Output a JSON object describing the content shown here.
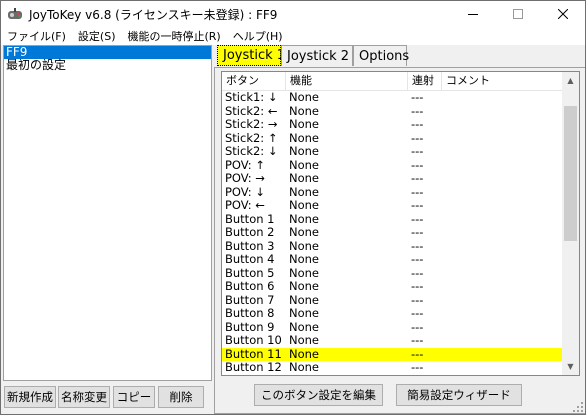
{
  "window": {
    "title": "JoyToKey v6.8 (ライセンスキー未登録) : FF9"
  },
  "menu": {
    "items": [
      {
        "label": "ファイル(F)"
      },
      {
        "label": "設定(S)"
      },
      {
        "label": "機能の一時停止(R)"
      },
      {
        "label": "ヘルプ(H)"
      }
    ]
  },
  "profiles": [
    "FF9",
    "最初の設定"
  ],
  "left_buttons": {
    "new": "新規作成",
    "rename": "名称変更",
    "copy": "コピー",
    "delete": "削除"
  },
  "tabs": [
    "Joystick 1",
    "Joystick 2",
    "Options"
  ],
  "list": {
    "columns": [
      "ボタン",
      "機能",
      "連射",
      "コメント"
    ],
    "rows": [
      {
        "button": "Stick1: ↓",
        "func": "None",
        "rapid": "---",
        "comment": ""
      },
      {
        "button": "Stick2: ←",
        "func": "None",
        "rapid": "---",
        "comment": ""
      },
      {
        "button": "Stick2: →",
        "func": "None",
        "rapid": "---",
        "comment": ""
      },
      {
        "button": "Stick2: ↑",
        "func": "None",
        "rapid": "---",
        "comment": ""
      },
      {
        "button": "Stick2: ↓",
        "func": "None",
        "rapid": "---",
        "comment": ""
      },
      {
        "button": "POV: ↑",
        "func": "None",
        "rapid": "---",
        "comment": ""
      },
      {
        "button": "POV: →",
        "func": "None",
        "rapid": "---",
        "comment": ""
      },
      {
        "button": "POV: ↓",
        "func": "None",
        "rapid": "---",
        "comment": ""
      },
      {
        "button": "POV: ←",
        "func": "None",
        "rapid": "---",
        "comment": ""
      },
      {
        "button": "Button 1",
        "func": "None",
        "rapid": "---",
        "comment": ""
      },
      {
        "button": "Button 2",
        "func": "None",
        "rapid": "---",
        "comment": ""
      },
      {
        "button": "Button 3",
        "func": "None",
        "rapid": "---",
        "comment": ""
      },
      {
        "button": "Button 4",
        "func": "None",
        "rapid": "---",
        "comment": ""
      },
      {
        "button": "Button 5",
        "func": "None",
        "rapid": "---",
        "comment": ""
      },
      {
        "button": "Button 6",
        "func": "None",
        "rapid": "---",
        "comment": ""
      },
      {
        "button": "Button 7",
        "func": "None",
        "rapid": "---",
        "comment": ""
      },
      {
        "button": "Button 8",
        "func": "None",
        "rapid": "---",
        "comment": ""
      },
      {
        "button": "Button 9",
        "func": "None",
        "rapid": "---",
        "comment": ""
      },
      {
        "button": "Button 10",
        "func": "None",
        "rapid": "---",
        "comment": ""
      },
      {
        "button": "Button 11",
        "func": "None",
        "rapid": "---",
        "comment": "",
        "highlight": true
      },
      {
        "button": "Button 12",
        "func": "None",
        "rapid": "---",
        "comment": ""
      }
    ]
  },
  "bottom_buttons": {
    "edit": "このボタン設定を編集",
    "wizard": "簡易設定ウィザード"
  },
  "colors": {
    "selection": "#0078d7",
    "highlight": "#ffff00"
  }
}
